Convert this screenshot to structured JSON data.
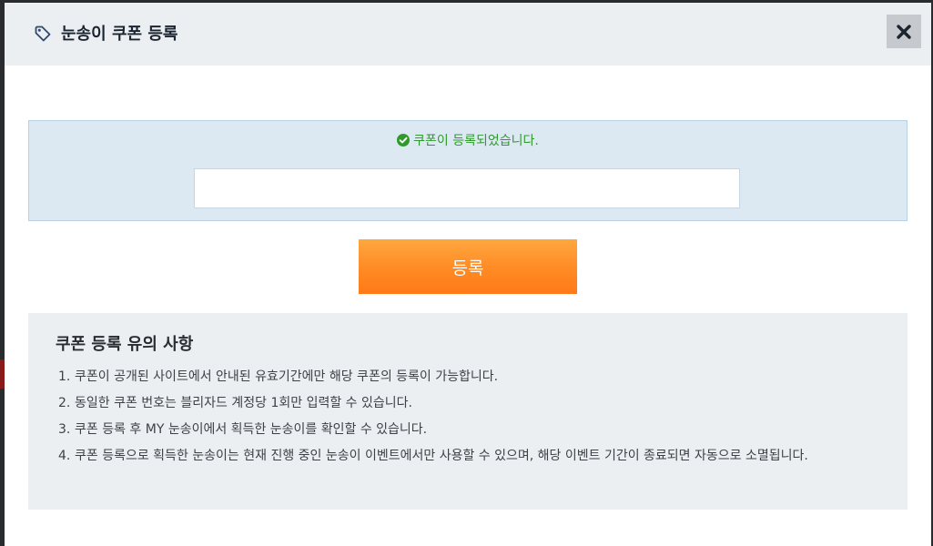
{
  "header": {
    "title": "눈송이 쿠폰 등록",
    "icon": "tag-icon",
    "close_icon": "close-icon"
  },
  "coupon": {
    "success_message": "쿠폰이 등록되었습니다.",
    "success_icon": "check-circle-icon",
    "input_value": "",
    "input_placeholder": ""
  },
  "register_button": {
    "label": "등록"
  },
  "notice": {
    "title": "쿠폰 등록 유의 사항",
    "items": [
      {
        "num": "1.",
        "text": "쿠폰이 공개된 사이트에서 안내된 유효기간에만 해당 쿠폰의 등록이 가능합니다."
      },
      {
        "num": "2.",
        "text": "동일한 쿠폰 번호는 블리자드 계정당 1회만 입력할 수 있습니다."
      },
      {
        "num": "3.",
        "text": "쿠폰 등록 후 MY 눈송이에서 획득한 눈송이를 확인할 수 있습니다."
      },
      {
        "num": "4.",
        "text": "쿠폰 등록으로 획득한 눈송이는 현재 진행 중인 눈송이 이벤트에서만 사용할 수 있으며, 해당 이벤트 기간이 종료되면 자동으로 소멸됩니다."
      }
    ]
  },
  "colors": {
    "success": "#2f9a2b",
    "button_top": "#ffa73f",
    "button_bottom": "#ff7a18",
    "panel_blue": "#dde9f2",
    "panel_gray": "#eceff2"
  }
}
